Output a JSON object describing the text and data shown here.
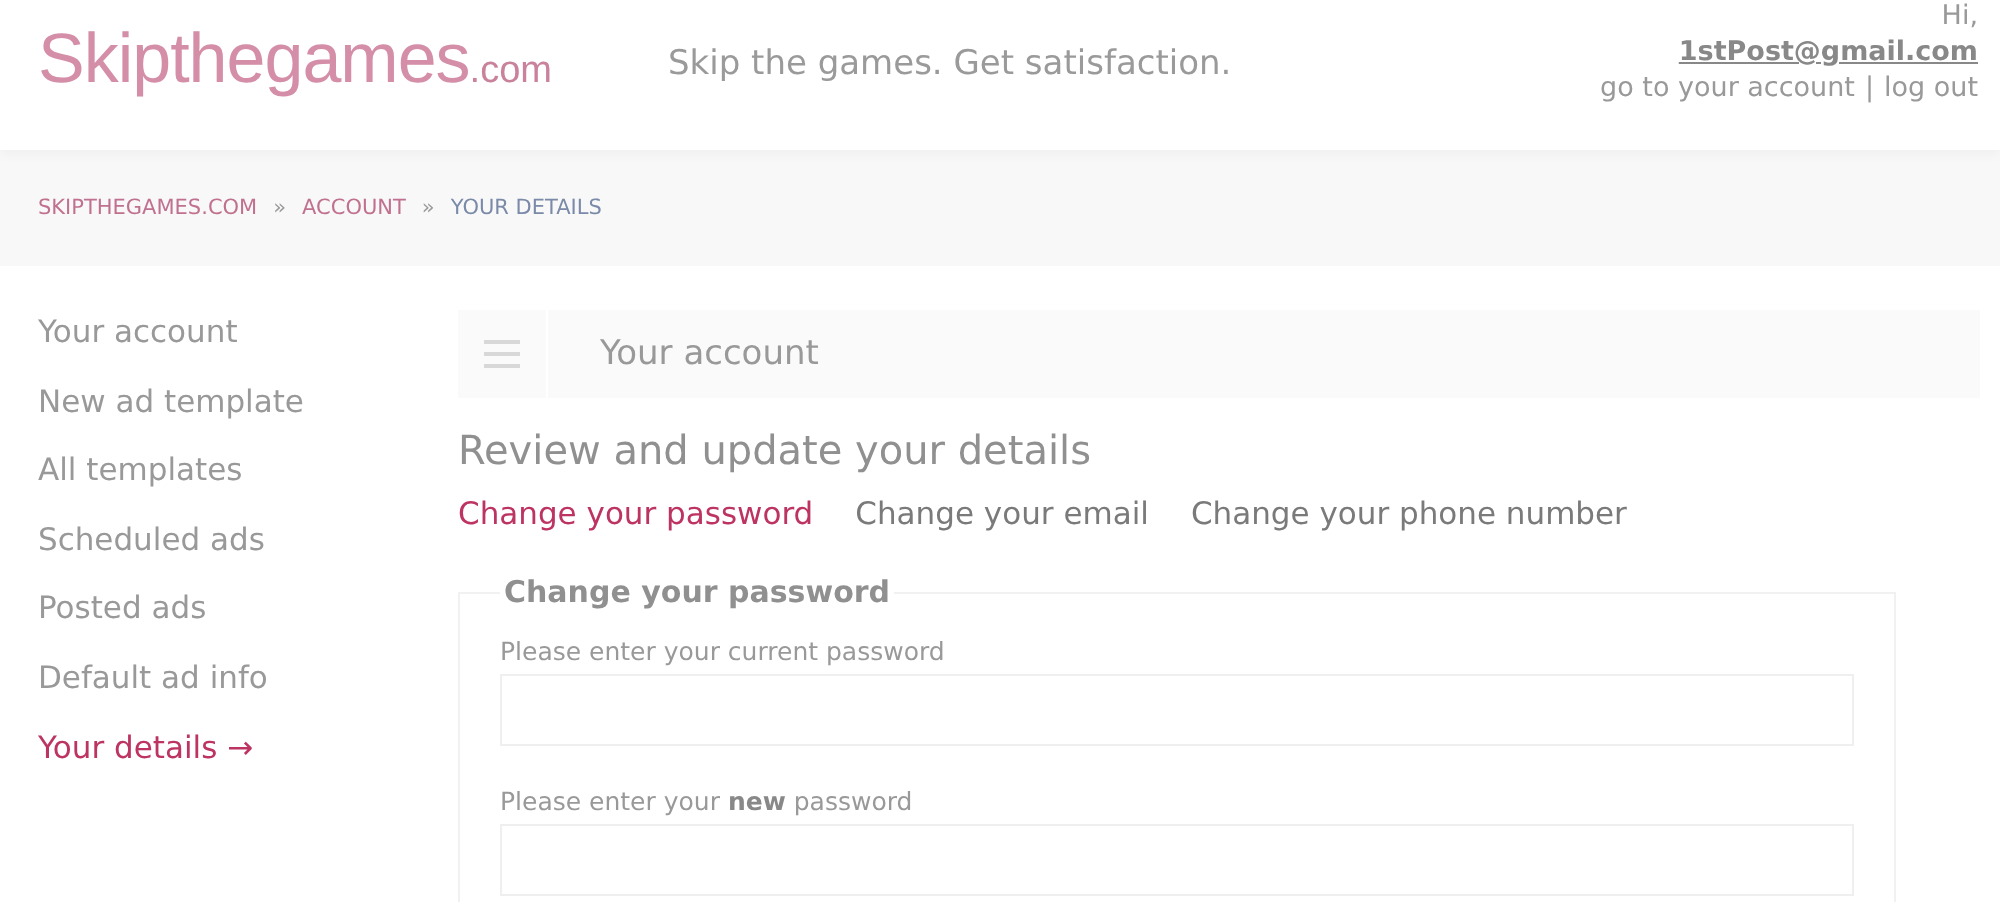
{
  "header": {
    "logo": {
      "name": "Skipthegames",
      "suffix": ".com"
    },
    "tagline": "Skip the games. Get satisfaction.",
    "greeting": "Hi,",
    "email": "1stPost@gmail.com",
    "links": [
      "go to your account",
      "log out"
    ],
    "link_separator": "|"
  },
  "breadcrumb": {
    "separator": "»",
    "items": [
      {
        "label": "SKIPTHEGAMES.COM",
        "current": false
      },
      {
        "label": "ACCOUNT",
        "current": false
      },
      {
        "label": "YOUR DETAILS",
        "current": true
      }
    ]
  },
  "sidebar": {
    "items": [
      {
        "label": "Your account",
        "selected": false
      },
      {
        "label": "New ad template",
        "selected": false
      },
      {
        "label": "All templates",
        "selected": false
      },
      {
        "label": "Scheduled ads",
        "selected": false
      },
      {
        "label": "Posted ads",
        "selected": false
      },
      {
        "label": "Default ad info",
        "selected": false
      },
      {
        "label": "Your details",
        "selected": true,
        "arrow": "→"
      }
    ]
  },
  "account_bar": {
    "title": "Your account"
  },
  "heading": "Review and update your details",
  "tabs": [
    {
      "label": "Change your password",
      "selected": true
    },
    {
      "label": "Change your email",
      "selected": false
    },
    {
      "label": "Change your phone number",
      "selected": false
    }
  ],
  "form": {
    "legend": "Change your password",
    "fields": [
      {
        "label": "Please enter your current password"
      },
      {
        "label": "Please enter your **new** password"
      }
    ]
  }
}
